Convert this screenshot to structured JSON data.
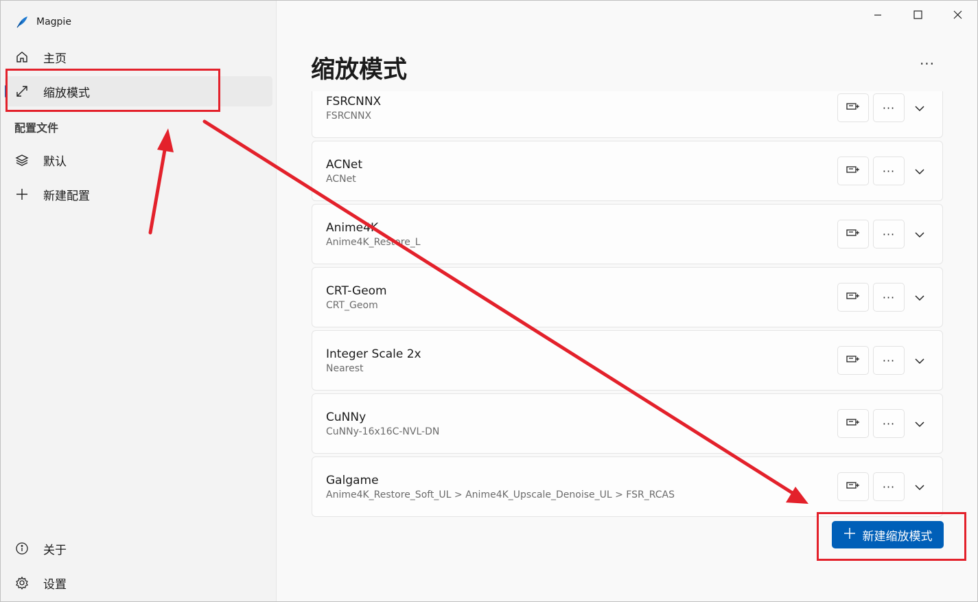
{
  "app": {
    "title": "Magpie"
  },
  "window_controls": {
    "minimize": "minimize-icon",
    "maximize": "maximize-icon",
    "close": "close-icon"
  },
  "sidebar": {
    "nav": [
      {
        "label": "主页",
        "icon": "home-icon"
      },
      {
        "label": "缩放模式",
        "icon": "resize-arrow-icon",
        "selected": true
      }
    ],
    "profiles_section": "配置文件",
    "profiles": [
      {
        "label": "默认",
        "icon": "layers-icon"
      },
      {
        "label": "新建配置",
        "icon": "plus-icon"
      }
    ],
    "footer": [
      {
        "label": "关于",
        "icon": "info-icon"
      },
      {
        "label": "设置",
        "icon": "gear-icon"
      }
    ]
  },
  "main": {
    "title": "缩放模式",
    "more": "···",
    "modes": [
      {
        "name": "FSRCNNX",
        "desc": "FSRCNNX"
      },
      {
        "name": "ACNet",
        "desc": "ACNet"
      },
      {
        "name": "Anime4K",
        "desc": "Anime4K_Restore_L"
      },
      {
        "name": "CRT-Geom",
        "desc": "CRT_Geom"
      },
      {
        "name": "Integer Scale 2x",
        "desc": "Nearest"
      },
      {
        "name": "CuNNy",
        "desc": "CuNNy-16x16C-NVL-DN"
      },
      {
        "name": "Galgame",
        "desc": "Anime4K_Restore_Soft_UL > Anime4K_Upscale_Denoise_UL > FSR_RCAS"
      }
    ],
    "card_more": "···",
    "new_mode_label": "新建缩放模式"
  },
  "colors": {
    "accent": "#005fb8",
    "annotation": "#e3212b",
    "sidebar_bg": "#f3f3f3"
  }
}
